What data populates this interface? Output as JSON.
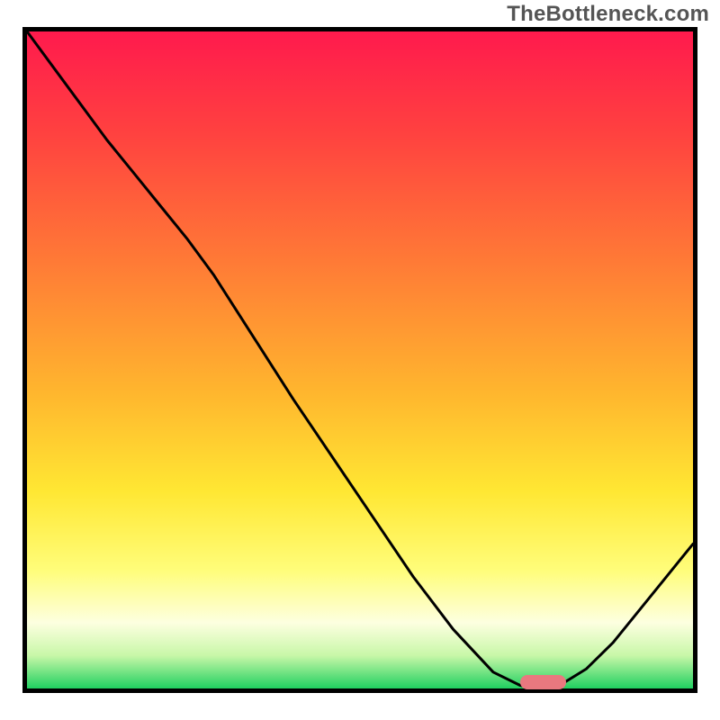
{
  "watermark": "TheBottleneck.com",
  "colors": {
    "border": "#000000",
    "curve": "#000000",
    "marker": "#e9787f",
    "watermark_text": "#555555",
    "gradient_stops": [
      {
        "pos": 0.0,
        "hex": "#ff1a4d"
      },
      {
        "pos": 0.15,
        "hex": "#ff4040"
      },
      {
        "pos": 0.35,
        "hex": "#ff7a36"
      },
      {
        "pos": 0.55,
        "hex": "#ffb62e"
      },
      {
        "pos": 0.7,
        "hex": "#ffe733"
      },
      {
        "pos": 0.82,
        "hex": "#fffd7a"
      },
      {
        "pos": 0.9,
        "hex": "#fdffe0"
      },
      {
        "pos": 0.95,
        "hex": "#c8f7a8"
      },
      {
        "pos": 1.0,
        "hex": "#20d060"
      }
    ]
  },
  "chart_data": {
    "type": "line",
    "title": "",
    "xlabel": "",
    "ylabel": "",
    "xlim": [
      0,
      100
    ],
    "ylim": [
      0,
      100
    ],
    "x": [
      0,
      4,
      8,
      12,
      16,
      20,
      24,
      28,
      34,
      40,
      46,
      52,
      58,
      64,
      70,
      74,
      76,
      78,
      80,
      84,
      88,
      92,
      96,
      100
    ],
    "values": [
      100,
      94.5,
      89,
      83.5,
      78.5,
      73.5,
      68.5,
      63,
      53.5,
      44,
      35,
      26,
      17,
      9,
      2.5,
      0.5,
      0,
      0,
      0.5,
      3,
      7,
      12,
      17,
      22
    ],
    "marker": {
      "x_start": 74,
      "x_end": 81,
      "y": 1.0
    }
  }
}
